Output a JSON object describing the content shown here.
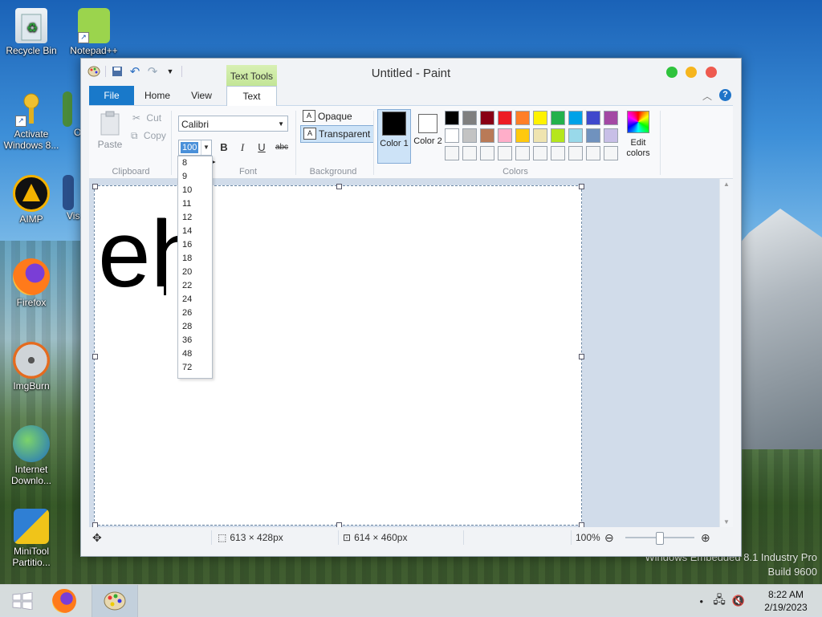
{
  "desktop": {
    "icons": [
      {
        "label": "Recycle Bin"
      },
      {
        "label": "Notepad++"
      },
      {
        "label": "Activate Windows 8..."
      },
      {
        "label": "AIMP"
      },
      {
        "label": "Firefox"
      },
      {
        "label": "ImgBurn"
      },
      {
        "label": "Internet Downlo..."
      },
      {
        "label": "MiniTool Partitio..."
      },
      {
        "label": "O"
      },
      {
        "label": "Vis"
      }
    ],
    "watermark_line1": "Windows Embedded 8.1 Industry Pro",
    "watermark_line2": "Build 9600"
  },
  "taskbar": {
    "time": "8:22 AM",
    "date": "2/19/2023"
  },
  "window": {
    "title": "Untitled - Paint",
    "context_tab": "Text Tools",
    "tabs": {
      "file": "File",
      "home": "Home",
      "view": "View",
      "text": "Text"
    },
    "clipboard": {
      "paste": "Paste",
      "cut": "Cut",
      "copy": "Copy",
      "label": "Clipboard"
    },
    "font": {
      "family": "Calibri",
      "size": "100",
      "label": "Font",
      "bold": "B",
      "italic": "I",
      "underline": "U",
      "strike": "abc"
    },
    "background": {
      "opaque": "Opaque",
      "transparent": "Transparent",
      "label": "Background"
    },
    "colors": {
      "color1_label": "Color 1",
      "color2_label": "Color 2",
      "edit_label": "Edit colors",
      "label": "Colors",
      "color1": "#000000",
      "color2": "#ffffff",
      "palette": [
        "#000000",
        "#7f7f7f",
        "#880015",
        "#ed1c24",
        "#ff7f27",
        "#fff200",
        "#22b14c",
        "#00a2e8",
        "#3f48cc",
        "#a349a4",
        "#ffffff",
        "#c3c3c3",
        "#b97a57",
        "#ffaec9",
        "#ffc90e",
        "#efe4b0",
        "#b5e61d",
        "#99d9ea",
        "#7092be",
        "#c8bfe7",
        "#f5f6f7",
        "#f5f6f7",
        "#f5f6f7",
        "#f5f6f7",
        "#f5f6f7",
        "#f5f6f7",
        "#f5f6f7",
        "#f5f6f7",
        "#f5f6f7",
        "#f5f6f7"
      ]
    },
    "font_size_options": [
      "8",
      "9",
      "10",
      "11",
      "12",
      "14",
      "16",
      "18",
      "20",
      "22",
      "24",
      "26",
      "28",
      "36",
      "48",
      "72"
    ],
    "canvas_text": "eh",
    "status": {
      "selection_size": "613 × 428px",
      "image_size": "614 × 460px",
      "zoom": "100%"
    }
  }
}
